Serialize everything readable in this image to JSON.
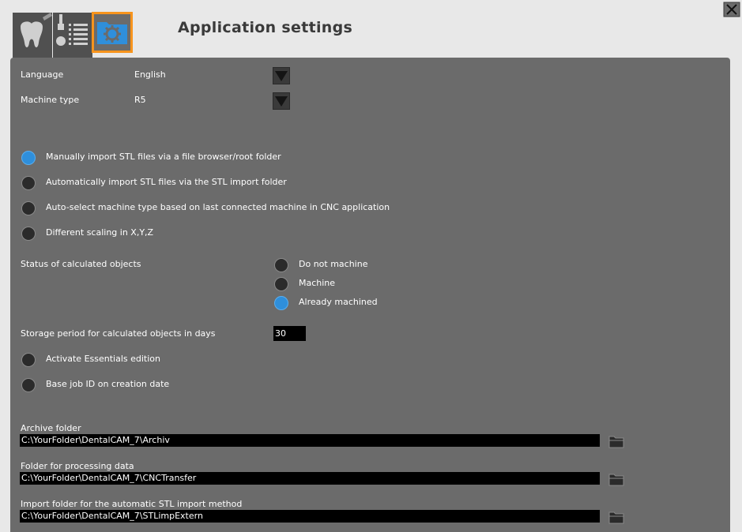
{
  "window": {
    "title": "Application settings"
  },
  "tabs": [
    {
      "name": "tooth",
      "icon": "tooth-icon"
    },
    {
      "name": "tools",
      "icon": "tools-list-icon"
    },
    {
      "name": "settings",
      "icon": "gear-folder-icon",
      "active": true
    }
  ],
  "accent_color": "#f7941d",
  "radio_on_color": "#2f8fdb",
  "settings": {
    "language": {
      "label": "Language",
      "value": "English"
    },
    "machine_type": {
      "label": "Machine type",
      "value": "R5"
    },
    "import_options": [
      {
        "label": "Manually import STL files via a file browser/root folder",
        "selected": true
      },
      {
        "label": "Automatically import STL files via the STL import folder",
        "selected": false
      },
      {
        "label": "Auto-select machine type based on last connected machine in CNC application",
        "selected": false
      },
      {
        "label": "Different scaling in X,Y,Z",
        "selected": false
      }
    ],
    "status": {
      "label": "Status of calculated objects",
      "options": [
        {
          "label": "Do not machine",
          "selected": false
        },
        {
          "label": "Machine",
          "selected": false
        },
        {
          "label": "Already machined",
          "selected": true
        }
      ]
    },
    "storage": {
      "label": "Storage period for calculated objects in days",
      "value": "30"
    },
    "extra_options": [
      {
        "label": "Activate Essentials edition",
        "selected": false
      },
      {
        "label": "Base job ID on creation date",
        "selected": false
      }
    ],
    "folders": [
      {
        "label": "Archive folder",
        "value": "C:\\YourFolder\\DentalCAM_7\\Archiv"
      },
      {
        "label": "Folder for processing data",
        "value": "C:\\YourFolder\\DentalCAM_7\\CNCTransfer"
      },
      {
        "label": "Import folder for the automatic STL import method",
        "value": "C:\\YourFolder\\DentalCAM_7\\STLimpExtern"
      }
    ]
  }
}
